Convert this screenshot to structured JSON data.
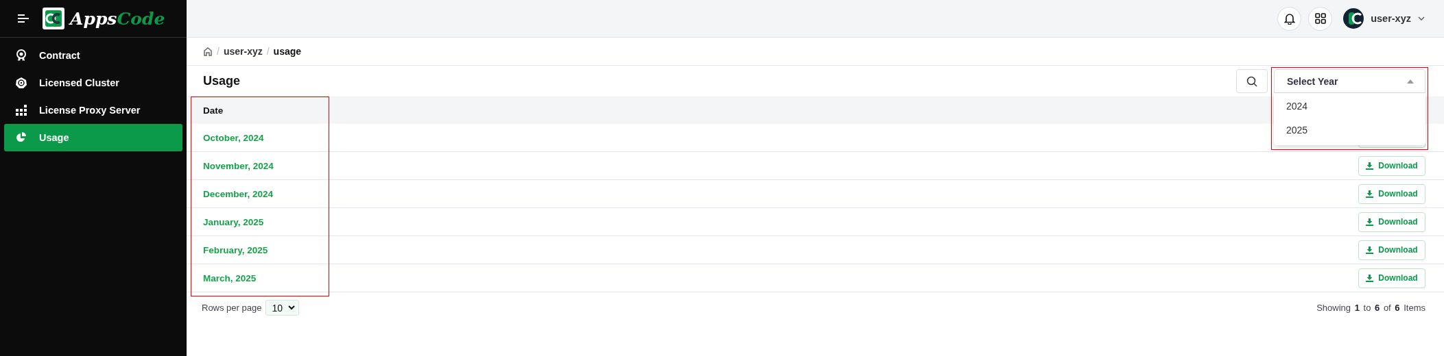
{
  "brand": {
    "left": "Apps",
    "right": "Code"
  },
  "sidebar": {
    "items": [
      {
        "label": "Contract",
        "kind": "contract",
        "selected": false
      },
      {
        "label": "Licensed Cluster",
        "kind": "cluster",
        "selected": false
      },
      {
        "label": "License Proxy Server",
        "kind": "proxy",
        "selected": false
      },
      {
        "label": "Usage",
        "kind": "usage",
        "selected": true
      }
    ]
  },
  "topbar": {
    "user": "user-xyz"
  },
  "breadcrumb": [
    {
      "separator": "/",
      "label": "user-xyz"
    },
    {
      "separator": "/",
      "label": "usage"
    }
  ],
  "page": {
    "title": "Usage"
  },
  "year_select": {
    "placeholder": "Select Year",
    "expanded": true,
    "highlighted": true,
    "options": [
      "2024",
      "2025"
    ]
  },
  "table": {
    "columns": [
      {
        "label": "Date",
        "highlighted": true
      }
    ],
    "rows": [
      {
        "date": "October, 2024"
      },
      {
        "date": "November, 2024",
        "download": "Download"
      },
      {
        "date": "December, 2024",
        "download": "Download"
      },
      {
        "date": "January, 2025",
        "download": "Download"
      },
      {
        "date": "February, 2025",
        "download": "Download"
      },
      {
        "date": "March, 2025",
        "download": "Download"
      }
    ]
  },
  "footer": {
    "rows_label": "Rows per page",
    "rows_value": "10",
    "showing": [
      "Showing",
      "1",
      "to",
      "6",
      "of",
      "6",
      "Items"
    ]
  }
}
